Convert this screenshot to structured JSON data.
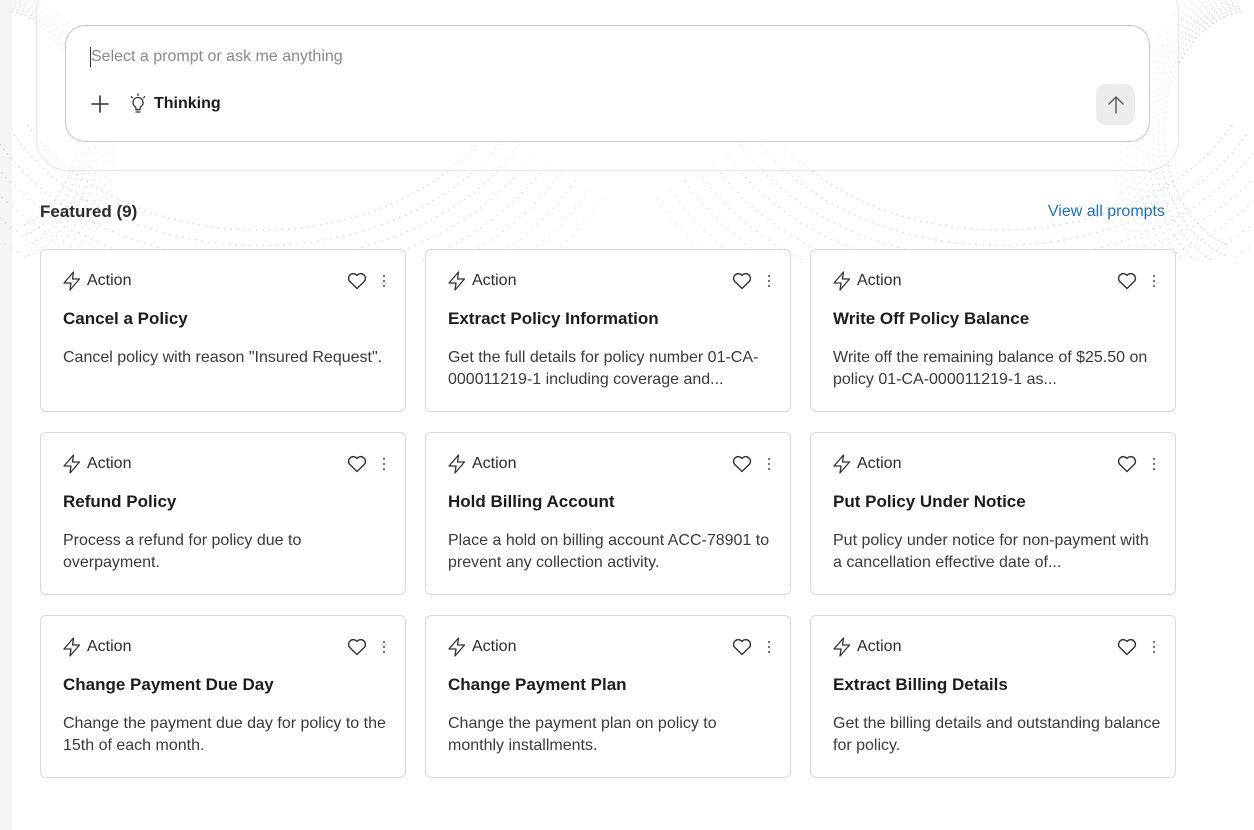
{
  "prompt": {
    "placeholder": "Select a prompt or ask me anything",
    "value": "",
    "thinking_label": "Thinking"
  },
  "featured": {
    "title": "Featured (9)",
    "view_all_label": "View all prompts"
  },
  "colors": {
    "accent_link": "#1a6fc9",
    "dot_green": "#8fc9a0",
    "dot_blue": "#7fb7d9"
  },
  "icons": {
    "add": "plus-icon",
    "thinking": "lightbulb-icon",
    "send": "arrow-up-icon",
    "action": "lightning-icon",
    "favorite": "heart-icon",
    "more": "more-vertical-icon"
  },
  "cards": [
    {
      "tag": "Action",
      "title": "Cancel a Policy",
      "description": "Cancel policy with reason \"Insured Request\"."
    },
    {
      "tag": "Action",
      "title": "Extract Policy Information",
      "description": "Get the full details for policy number 01-CA-000011219-1 including coverage and..."
    },
    {
      "tag": "Action",
      "title": "Write Off Policy Balance",
      "description": "Write off the remaining balance of $25.50 on policy 01-CA-000011219-1 as..."
    },
    {
      "tag": "Action",
      "title": "Refund Policy",
      "description": "Process a refund for policy due to overpayment."
    },
    {
      "tag": "Action",
      "title": "Hold Billing Account",
      "description": "Place a hold on billing account ACC-78901 to prevent any collection activity."
    },
    {
      "tag": "Action",
      "title": "Put Policy Under Notice",
      "description": "Put policy under notice for non-payment with a cancellation effective date of..."
    },
    {
      "tag": "Action",
      "title": "Change Payment Due Day",
      "description": "Change the payment due day for policy to the 15th of each month."
    },
    {
      "tag": "Action",
      "title": "Change Payment Plan",
      "description": "Change the payment plan on policy to monthly installments."
    },
    {
      "tag": "Action",
      "title": "Extract Billing Details",
      "description": "Get the billing details and outstanding balance for policy."
    }
  ]
}
